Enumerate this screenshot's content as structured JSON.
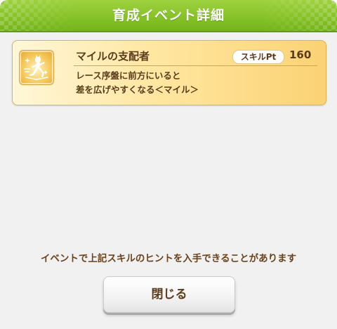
{
  "dialog": {
    "title": "育成イベント詳細"
  },
  "skill": {
    "name": "マイルの支配者",
    "pt_label": "スキルPt",
    "pt_value": "160",
    "description_lines": [
      "レース序盤に前方にいると",
      "差を広げやすくなる＜マイル＞"
    ],
    "icon": "running-horse-girl-icon"
  },
  "hint": "イベントで上記スキルのヒントを入手できることがあります",
  "buttons": {
    "close_label": "閉じる"
  }
}
